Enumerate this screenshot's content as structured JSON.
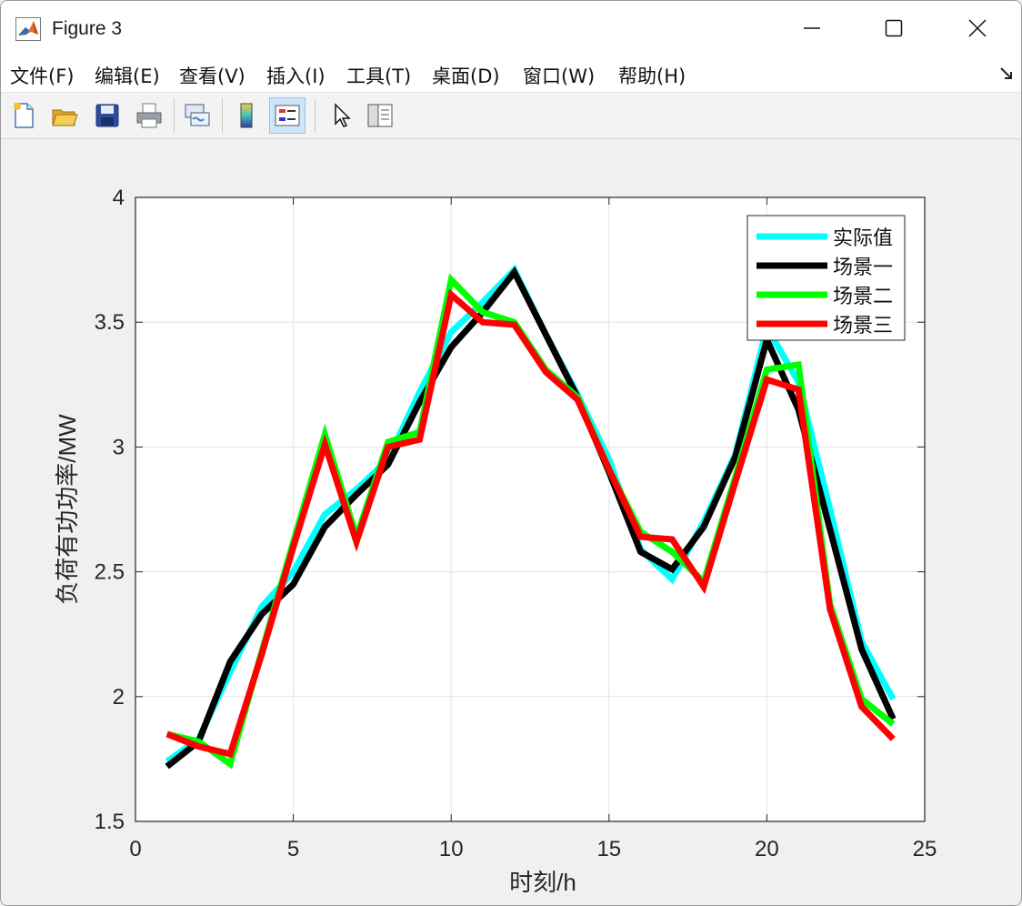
{
  "window": {
    "title": "Figure 3"
  },
  "menu": {
    "items": [
      {
        "label": "文件(F)",
        "key": "F"
      },
      {
        "label": "编辑(E)",
        "key": "E"
      },
      {
        "label": "查看(V)",
        "key": "V"
      },
      {
        "label": "插入(I)",
        "key": "I"
      },
      {
        "label": "工具(T)",
        "key": "T"
      },
      {
        "label": "桌面(D)",
        "key": "D"
      },
      {
        "label": "窗口(W)",
        "key": "W"
      },
      {
        "label": "帮助(H)",
        "key": "H"
      }
    ]
  },
  "toolbar": {
    "icons": [
      "new-figure-icon",
      "open-file-icon",
      "save-icon",
      "print-icon",
      "link-plot-icon",
      "colorbar-icon",
      "legend-icon",
      "edit-plot-arrow-icon",
      "property-inspector-icon"
    ],
    "active": "legend-icon"
  },
  "chart_data": {
    "type": "line",
    "xlabel": "时刻/h",
    "ylabel": "负荷有功功率/MW",
    "xlim": [
      0,
      25
    ],
    "ylim": [
      1.5,
      4
    ],
    "xticks": [
      "0",
      "5",
      "10",
      "15",
      "20",
      "25"
    ],
    "yticks": [
      "1.5",
      "2",
      "2.5",
      "3",
      "3.5",
      "4"
    ],
    "grid": true,
    "legend_position": "top-right",
    "x": [
      1,
      2,
      3,
      4,
      5,
      6,
      7,
      8,
      9,
      10,
      11,
      12,
      13,
      14,
      15,
      16,
      17,
      18,
      19,
      20,
      21,
      22,
      23,
      24
    ],
    "series": [
      {
        "name": "实际值",
        "color": "#00ffff",
        "values": [
          1.74,
          1.83,
          2.1,
          2.36,
          2.5,
          2.73,
          2.83,
          2.95,
          3.22,
          3.46,
          3.58,
          3.71,
          3.45,
          3.21,
          2.95,
          2.59,
          2.47,
          2.7,
          2.97,
          3.48,
          3.26,
          2.75,
          2.22,
          1.99
        ]
      },
      {
        "name": "场景一",
        "color": "#000000",
        "values": [
          1.72,
          1.82,
          2.14,
          2.33,
          2.45,
          2.68,
          2.81,
          2.93,
          3.18,
          3.4,
          3.54,
          3.7,
          3.45,
          3.2,
          2.9,
          2.58,
          2.51,
          2.68,
          2.96,
          3.43,
          3.15,
          2.67,
          2.19,
          1.91
        ]
      },
      {
        "name": "场景二",
        "color": "#00ff00",
        "values": [
          1.85,
          1.82,
          1.73,
          2.18,
          2.62,
          3.05,
          2.64,
          3.02,
          3.06,
          3.67,
          3.54,
          3.5,
          3.31,
          3.2,
          2.91,
          2.66,
          2.58,
          2.46,
          2.88,
          3.31,
          3.33,
          2.37,
          1.99,
          1.89
        ]
      },
      {
        "name": "场景三",
        "color": "#ff0000",
        "values": [
          1.85,
          1.8,
          1.77,
          2.17,
          2.6,
          3.01,
          2.62,
          3.0,
          3.03,
          3.61,
          3.5,
          3.49,
          3.3,
          3.19,
          2.91,
          2.64,
          2.63,
          2.44,
          2.86,
          3.27,
          3.23,
          2.35,
          1.96,
          1.83
        ]
      }
    ]
  }
}
